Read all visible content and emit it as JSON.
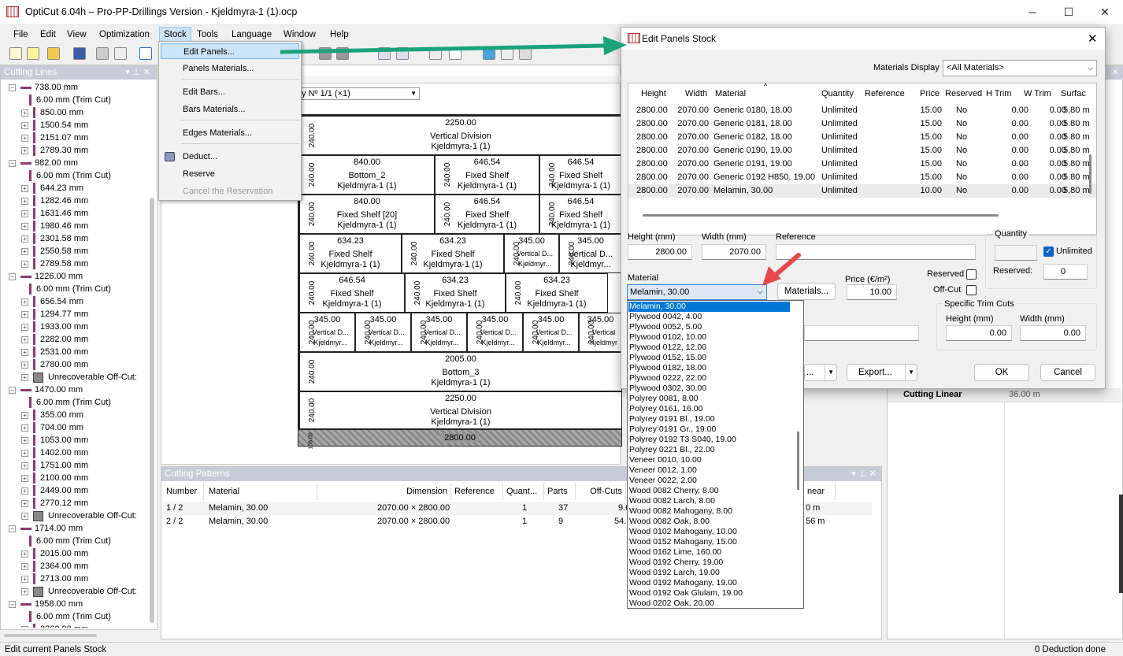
{
  "window": {
    "title": "OptiCut 6.04h – Pro-PP-Drillings Version - Kjeldmyra-1 (1).ocp",
    "minimize": "–",
    "maximize": "☐",
    "close": "✕"
  },
  "menubar": [
    "File",
    "Edit",
    "View",
    "Optimization",
    "Stock",
    "Tools",
    "Language",
    "Window",
    "Help"
  ],
  "stock_menu": {
    "edit_panels": "Edit Panels...",
    "panels_materials": "Panels Materials...",
    "edit_bars": "Edit Bars...",
    "bars_materials": "Bars Materials...",
    "edges_materials": "Edges Materials...",
    "deduct": "Deduct...",
    "reserve": "Reserve",
    "cancel_reservation": "Cancel the Reservation"
  },
  "left_pane": {
    "title": "Cutting Lines",
    "pin": "▾ ⊥ ✕",
    "items": [
      {
        "t": "h",
        "v": "738.00 mm"
      },
      {
        "t": "trim",
        "v": "6.00 mm (Trim Cut)"
      },
      {
        "t": "c",
        "v": "850.00 mm"
      },
      {
        "t": "c",
        "v": "1500.54 mm"
      },
      {
        "t": "c",
        "v": "2151.07 mm"
      },
      {
        "t": "c",
        "v": "2789.30 mm"
      },
      {
        "t": "h",
        "v": "982.00 mm"
      },
      {
        "t": "trim",
        "v": "6.00 mm (Trim Cut)"
      },
      {
        "t": "c",
        "v": "644.23 mm"
      },
      {
        "t": "c",
        "v": "1282.46 mm"
      },
      {
        "t": "c",
        "v": "1631.46 mm"
      },
      {
        "t": "c",
        "v": "1980.46 mm"
      },
      {
        "t": "c",
        "v": "2301.58 mm"
      },
      {
        "t": "c",
        "v": "2550.58 mm"
      },
      {
        "t": "c",
        "v": "2789.58 mm"
      },
      {
        "t": "h",
        "v": "1226.00 mm"
      },
      {
        "t": "trim",
        "v": "6.00 mm (Trim Cut)"
      },
      {
        "t": "c",
        "v": "656.54 mm"
      },
      {
        "t": "c",
        "v": "1294.77 mm"
      },
      {
        "t": "c",
        "v": "1933.00 mm"
      },
      {
        "t": "c",
        "v": "2282.00 mm"
      },
      {
        "t": "c",
        "v": "2531.00 mm"
      },
      {
        "t": "c",
        "v": "2780.00 mm"
      },
      {
        "t": "off",
        "v": "Unrecoverable Off-Cut:"
      },
      {
        "t": "h",
        "v": "1470.00 mm"
      },
      {
        "t": "trim",
        "v": "6.00 mm (Trim Cut)"
      },
      {
        "t": "c",
        "v": "355.00 mm"
      },
      {
        "t": "c",
        "v": "704.00 mm"
      },
      {
        "t": "c",
        "v": "1053.00 mm"
      },
      {
        "t": "c",
        "v": "1402.00 mm"
      },
      {
        "t": "c",
        "v": "1751.00 mm"
      },
      {
        "t": "c",
        "v": "2100.00 mm"
      },
      {
        "t": "c",
        "v": "2449.00 mm"
      },
      {
        "t": "c",
        "v": "2770.12 mm"
      },
      {
        "t": "off",
        "v": "Unrecoverable Off-Cut:"
      },
      {
        "t": "h",
        "v": "1714.00 mm"
      },
      {
        "t": "trim",
        "v": "6.00 mm (Trim Cut)"
      },
      {
        "t": "c",
        "v": "2015.00 mm"
      },
      {
        "t": "c",
        "v": "2364.00 mm"
      },
      {
        "t": "c",
        "v": "2713.00 mm"
      },
      {
        "t": "off",
        "v": "Unrecoverable Off-Cut:"
      },
      {
        "t": "h",
        "v": "1958.00 mm"
      },
      {
        "t": "trim",
        "v": "6.00 mm (Trim Cut)"
      },
      {
        "t": "c",
        "v": "2362.00 mm"
      }
    ]
  },
  "layout_select": "y Nº 1/1 (×1)",
  "board_pieces": [
    {
      "w": "2250.00",
      "h": "240.00",
      "n": "Vertical Division",
      "r": "Kjeldmyra-1 (1)"
    },
    {
      "w": "840.00",
      "h": "240.00",
      "n": "Bottom_2",
      "r": "Kjeldmyra-1 (1)"
    },
    {
      "w": "646.54",
      "h": "240.00",
      "n": "Fixed Shelf",
      "r": "Kjeldmyra-1 (1)"
    },
    {
      "w": "646.54",
      "h": "240.00",
      "n": "Fixed Shelf",
      "r": "Kjeldmyra-1 (1)"
    },
    {
      "w": "840.00",
      "h": "240.00",
      "n": "Fixed Shelf [20]",
      "r": "Kjeldmyra-1 (1)"
    },
    {
      "w": "646.54",
      "h": "240.00",
      "n": "Fixed Shelf",
      "r": "Kjeldmyra-1 (1)"
    },
    {
      "w": "646.54",
      "h": "240.00",
      "n": "Fixed Shelf",
      "r": "Kjeldmyra-1 (1)"
    },
    {
      "w": "634.23",
      "h": "240.00",
      "n": "Fixed Shelf",
      "r": "Kjeldmyra-1 (1)"
    },
    {
      "w": "634.23",
      "h": "240.00",
      "n": "Fixed Shelf",
      "r": "Kjeldmyra-1 (1)"
    },
    {
      "w": "345.00",
      "h": "240.00",
      "n": "Vertical D...",
      "r": "Kjeldmyr..."
    },
    {
      "w": "345.00",
      "h": "240.00",
      "n": "Vertical D...",
      "r": "Kjeldmyr..."
    },
    {
      "w": "646.54",
      "h": "240.00",
      "n": "Fixed Shelf",
      "r": "Kjeldmyra-1 (1)"
    },
    {
      "w": "634.23",
      "h": "240.00",
      "n": "Fixed Shelf",
      "r": "Kjeldmyra-1 (1)"
    },
    {
      "w": "634.23",
      "h": "240.00",
      "n": "Fixed Shelf",
      "r": "Kjeldmyra-1 (1)"
    },
    {
      "w": "345.00",
      "h": "240.00",
      "n": "Vertical D...",
      "r": "Kjeldmyr..."
    },
    {
      "w": "345.00",
      "h": "240.00",
      "n": "Vertical D...",
      "r": "Kjeldmyr..."
    },
    {
      "w": "345.00",
      "h": "240.00",
      "n": "Vertical D...",
      "r": "Kjeldmyr..."
    },
    {
      "w": "345.00",
      "h": "240.00",
      "n": "Vertical D...",
      "r": "Kjeldmyr..."
    },
    {
      "w": "345.00",
      "h": "240.00",
      "n": "Vertical D...",
      "r": "Kjeldmyr..."
    },
    {
      "w": "345.00",
      "h": "240.00",
      "n": "Vertical",
      "r": "Kjeldmyr"
    },
    {
      "w": "2005.00",
      "h": "240.00",
      "n": "Bottom_3",
      "r": "Kjeldmyra-1 (1)"
    },
    {
      "w": "2250.00",
      "h": "240.00",
      "n": "Vertical Division",
      "r": "Kjeldmyra-1 (1)"
    }
  ],
  "board_bottom": {
    "left": "108.00",
    "center": "2800.00"
  },
  "patterns": {
    "title": "Cutting Patterns",
    "headers": [
      "Number",
      "Material",
      "Dimension",
      "Reference",
      "Quant...",
      "Parts",
      "Off-Cuts",
      "near"
    ],
    "rows": [
      [
        "1 / 2",
        "Melamin, 30.00",
        "2070.00 × 2800.00",
        "",
        "1",
        "37",
        "9.6",
        "0 m"
      ],
      [
        "2 / 2",
        "Melamin, 30.00",
        "2070.00 × 2800.00",
        "",
        "1",
        "9",
        "54.1",
        "56 m"
      ]
    ]
  },
  "right_panel": {
    "label": "Cutting Linear",
    "value": "36.00 m"
  },
  "status": {
    "left": "Edit current Panels Stock",
    "right": "0 Deduction done"
  },
  "dialog": {
    "title": "Edit Panels Stock",
    "close": "✕",
    "materials_display_label": "Materials Display",
    "materials_display_value": "<All Materials>",
    "columns": [
      "Height",
      "Width",
      "Material",
      "Quantity",
      "Reference",
      "Price",
      "Reserved",
      "H Trim",
      "W Trim",
      "Surfac"
    ],
    "rows": [
      [
        "2800.00",
        "2070.00",
        "Generic 0180, 18.00",
        "Unlimited",
        "",
        "15.00",
        "No",
        "0.00",
        "0.00",
        "5.80 m"
      ],
      [
        "2800.00",
        "2070.00",
        "Generic 0181, 18.00",
        "Unlimited",
        "",
        "15.00",
        "No",
        "0.00",
        "0.00",
        "5.80 m"
      ],
      [
        "2800.00",
        "2070.00",
        "Generic 0182, 18.00",
        "Unlimited",
        "",
        "15.00",
        "No",
        "0.00",
        "0.00",
        "5.80 m"
      ],
      [
        "2800.00",
        "2070.00",
        "Generic 0190, 19.00",
        "Unlimited",
        "",
        "15.00",
        "No",
        "0.00",
        "0.00",
        "5.80 m"
      ],
      [
        "2800.00",
        "2070.00",
        "Generic 0191, 19.00",
        "Unlimited",
        "",
        "15.00",
        "No",
        "0.00",
        "0.00",
        "5.80 m"
      ],
      [
        "2800.00",
        "2070.00",
        "Generic 0192 H850, 19.00",
        "Unlimited",
        "",
        "15.00",
        "No",
        "0.00",
        "0.00",
        "5.80 m"
      ],
      [
        "2800.00",
        "2070.00",
        "Melamin, 30.00",
        "Unlimited",
        "",
        "10.00",
        "No",
        "0.00",
        "0.00",
        "5.80 m"
      ]
    ],
    "height_label": "Height (mm)",
    "height_value": "2800.00",
    "width_label": "Width (mm)",
    "width_value": "2070.00",
    "reference_label": "Reference",
    "quantity_label": "Quantity",
    "unlimited_label": "Unlimited",
    "reserved_qty_label": "Reserved:",
    "reserved_qty_value": "0",
    "material_label": "Material",
    "material_value": "Melamin, 30.00",
    "materials_btn": "Materials...",
    "price_label": "Price (€/m²)",
    "price_value": "10.00",
    "reserved_label": "Reserved",
    "offcut_label": "Off-Cut",
    "trim_group": "Specific Trim Cuts",
    "trim_height_label": "Height (mm)",
    "trim_height_value": "0.00",
    "trim_width_label": "Width (mm)",
    "trim_width_value": "0.00",
    "import_btn": "...",
    "export_btn": "Export...",
    "ok_btn": "OK",
    "cancel_btn": "Cancel"
  },
  "material_list": [
    "Melamin, 30.00",
    "Plywood 0042, 4.00",
    "Plywood 0052, 5.00",
    "Plywood 0102, 10.00",
    "Plywood 0122, 12.00",
    "Plywood 0152, 15.00",
    "Plywood 0182, 18.00",
    "Plywood 0222, 22.00",
    "Plywood 0302, 30.00",
    "Polyrey 0081, 8.00",
    "Polyrey 0161, 16.00",
    "Polyrey 0191 Bl., 19.00",
    "Polyrey 0191 Gr., 19.00",
    "Polyrey 0192 T3 S040, 19.00",
    "Polyrey 0221 Bl., 22.00",
    "Veneer 0010, 10.00",
    "Veneer 0012, 1.00",
    "Veneer 0022, 2.00",
    "Wood 0082 Cherry, 8.00",
    "Wood 0082 Larch, 8.00",
    "Wood 0082 Mahogany, 8.00",
    "Wood 0082 Oak, 8.00",
    "Wood 0102 Mahogany, 10.00",
    "Wood 0152 Mahogany, 15.00",
    "Wood 0162 Lime, 160.00",
    "Wood 0192 Cherry, 19.00",
    "Wood 0192 Larch, 19.00",
    "Wood 0192 Mahogany, 19.00",
    "Wood 0192 Oak Glulam, 19.00",
    "Wood 0202 Oak, 20.00"
  ],
  "colors": {
    "accent": "#0078d7",
    "arrow_green": "#1aa37a",
    "arrow_red": "#e8484a",
    "cut_bar": "#8c3c6e",
    "pane_header": "#c6cdd8"
  }
}
